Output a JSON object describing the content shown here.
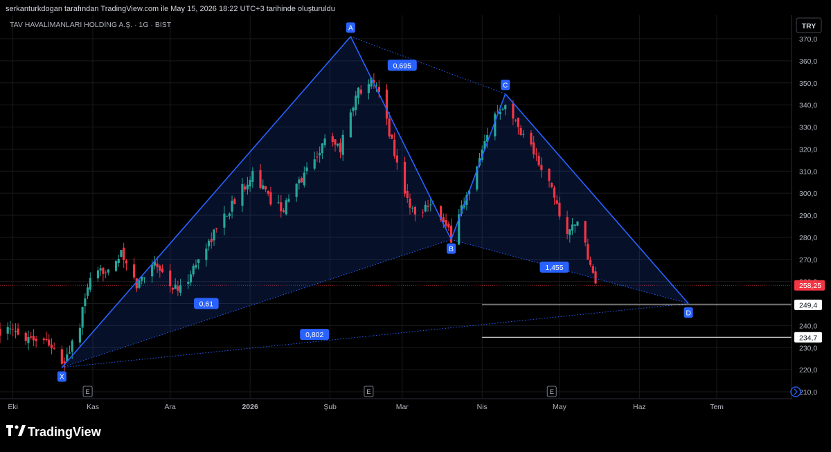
{
  "header": {
    "caption": "serkanturkdogan tarafından TradingView.com ile May 15, 2026 18:22 UTC+3 tarihinde oluşturuldu"
  },
  "footer": {
    "brand": "TradingView"
  },
  "colors": {
    "background": "#000000",
    "up": "#26a69a",
    "down": "#f23645",
    "pattern": "#2962ff",
    "grid": "#1a1a1a",
    "price_badge": "#f23645"
  },
  "chart_data": {
    "type": "candlestick",
    "title": "TAV HAVALİMANLARI HOLDİNG A.Ş. · 1G · BIST",
    "currency": "TRY",
    "current_price": 258.25,
    "current_price_label": "258,25",
    "ylim": [
      205,
      375
    ],
    "y_ticks": [
      210,
      220,
      230,
      240,
      250,
      260,
      270,
      280,
      290,
      300,
      310,
      320,
      330,
      340,
      350,
      360,
      370
    ],
    "y_tick_labels": [
      "210,0",
      "220,0",
      "230,0",
      "240,0",
      "250,0",
      "260,0",
      "270,0",
      "280,0",
      "290,0",
      "300,0",
      "310,0",
      "320,0",
      "330,0",
      "340,0",
      "350,0",
      "360,0",
      "370,0"
    ],
    "x_axis": {
      "range": [
        "2025-09-26",
        "2026-07-30"
      ],
      "labels": [
        {
          "label": "Eki",
          "date": "2025-10-01",
          "bold": false
        },
        {
          "label": "Kas",
          "date": "2025-11-01",
          "bold": false
        },
        {
          "label": "Ara",
          "date": "2025-12-01",
          "bold": false
        },
        {
          "label": "2026",
          "date": "2026-01-01",
          "bold": true
        },
        {
          "label": "Şub",
          "date": "2026-02-01",
          "bold": false
        },
        {
          "label": "Mar",
          "date": "2026-03-01",
          "bold": false
        },
        {
          "label": "Nis",
          "date": "2026-04-01",
          "bold": false
        },
        {
          "label": "May",
          "date": "2026-05-01",
          "bold": false
        },
        {
          "label": "Haz",
          "date": "2026-06-01",
          "bold": false
        },
        {
          "label": "Tem",
          "date": "2026-07-01",
          "bold": false
        }
      ]
    },
    "pattern": {
      "points": [
        {
          "label": "X",
          "date": "2025-10-20",
          "price": 221
        },
        {
          "label": "A",
          "date": "2026-02-09",
          "price": 371
        },
        {
          "label": "B",
          "date": "2026-03-20",
          "price": 279
        },
        {
          "label": "C",
          "date": "2026-04-10",
          "price": 345
        },
        {
          "label": "D",
          "date": "2026-06-20",
          "price": 250
        }
      ],
      "ratios": [
        {
          "label": "0,695",
          "date": "2026-03-01",
          "price": 358
        },
        {
          "label": "0,61",
          "date": "2025-12-15",
          "price": 250
        },
        {
          "label": "1,455",
          "date": "2026-04-29",
          "price": 266.5
        },
        {
          "label": "0,802",
          "date": "2026-01-26",
          "price": 236
        }
      ]
    },
    "levels": [
      {
        "label": "249,4",
        "price": 249.4,
        "start": "2026-04-01"
      },
      {
        "label": "234,7",
        "price": 234.7,
        "start": "2026-04-01"
      }
    ],
    "event_markers": [
      {
        "label": "E",
        "date": "2025-10-30"
      },
      {
        "label": "E",
        "date": "2026-02-16"
      },
      {
        "label": "E",
        "date": "2026-04-28"
      }
    ],
    "anchors": [
      [
        "2025-09-26",
        238
      ],
      [
        "2025-10-08",
        235
      ],
      [
        "2025-10-15",
        233
      ],
      [
        "2025-10-20",
        221
      ],
      [
        "2025-10-27",
        240
      ],
      [
        "2025-10-30",
        258
      ],
      [
        "2025-11-06",
        266
      ],
      [
        "2025-11-12",
        272
      ],
      [
        "2025-11-18",
        258
      ],
      [
        "2025-11-25",
        270
      ],
      [
        "2025-12-01",
        258
      ],
      [
        "2025-12-05",
        256
      ],
      [
        "2025-12-12",
        270
      ],
      [
        "2025-12-20",
        286
      ],
      [
        "2025-12-28",
        300
      ],
      [
        "2026-01-02",
        310
      ],
      [
        "2026-01-08",
        298
      ],
      [
        "2026-01-14",
        293
      ],
      [
        "2026-01-20",
        305
      ],
      [
        "2026-01-26",
        316
      ],
      [
        "2026-02-01",
        327
      ],
      [
        "2026-02-05",
        320
      ],
      [
        "2026-02-09",
        338
      ],
      [
        "2026-02-12",
        346
      ],
      [
        "2026-02-16",
        352
      ],
      [
        "2026-02-20",
        345
      ],
      [
        "2026-02-24",
        328
      ],
      [
        "2026-03-02",
        300
      ],
      [
        "2026-03-06",
        290
      ],
      [
        "2026-03-12",
        297
      ],
      [
        "2026-03-17",
        286
      ],
      [
        "2026-03-20",
        280
      ],
      [
        "2026-03-24",
        294
      ],
      [
        "2026-03-27",
        300
      ],
      [
        "2026-04-01",
        318
      ],
      [
        "2026-04-06",
        336
      ],
      [
        "2026-04-10",
        342
      ],
      [
        "2026-04-14",
        332
      ],
      [
        "2026-04-20",
        322
      ],
      [
        "2026-04-24",
        310
      ],
      [
        "2026-04-28",
        302
      ],
      [
        "2026-05-04",
        280
      ],
      [
        "2026-05-07",
        288
      ],
      [
        "2026-05-12",
        272
      ],
      [
        "2026-05-15",
        258
      ]
    ]
  }
}
